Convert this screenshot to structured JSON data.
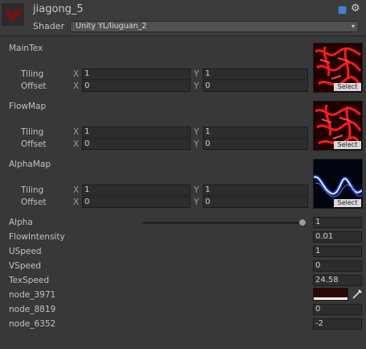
{
  "material": {
    "name": "jiagong_5",
    "shader_label": "Shader",
    "shader_value": "Unity YL/liuguan_2"
  },
  "textures": [
    {
      "label": "MainTex",
      "tiling_label": "Tiling",
      "offset_label": "Offset",
      "tiling_x": "1",
      "tiling_y": "1",
      "offset_x": "0",
      "offset_y": "0",
      "select_label": "Select"
    },
    {
      "label": "FlowMap",
      "tiling_label": "Tiling",
      "offset_label": "Offset",
      "tiling_x": "1",
      "tiling_y": "1",
      "offset_x": "0",
      "offset_y": "0",
      "select_label": "Select"
    },
    {
      "label": "AlphaMap",
      "tiling_label": "Tiling",
      "offset_label": "Offset",
      "tiling_x": "1",
      "tiling_y": "1",
      "offset_x": "0",
      "offset_y": "0",
      "select_label": "Select"
    }
  ],
  "axis": {
    "x": "X",
    "y": "Y"
  },
  "properties": {
    "alpha": {
      "label": "Alpha",
      "value": "1",
      "slider_fraction": 1.0
    },
    "flow_intensity": {
      "label": "FlowIntensity",
      "value": "0.01"
    },
    "uspeed": {
      "label": "USpeed",
      "value": "1"
    },
    "vspeed": {
      "label": "VSpeed",
      "value": "0"
    },
    "tex_speed": {
      "label": "TexSpeed",
      "value": "24.58"
    },
    "node_3971": {
      "label": "node_3971",
      "color": "#2c0505"
    },
    "node_8819": {
      "label": "node_8819",
      "value": "0"
    },
    "node_6352": {
      "label": "node_6352",
      "value": "-2"
    }
  },
  "colors": {
    "background": "#383838",
    "field_bg": "#2d2d2d",
    "accent_red": "#e00000",
    "accent_blue": "#3d6cff"
  }
}
